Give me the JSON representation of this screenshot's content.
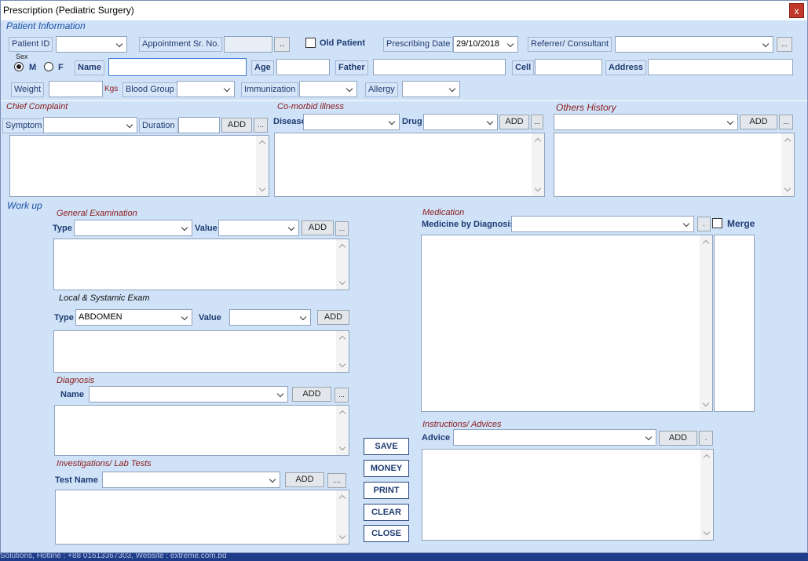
{
  "window": {
    "title": "Prescription (Pediatric Surgery)",
    "close_glyph": "x"
  },
  "patient_info": {
    "heading": "Patient Information",
    "patient_id_label": "Patient ID",
    "appointment_label": "Appointment Sr. No.",
    "appointment_browse": "..",
    "old_patient_label": "Old Patient",
    "prescribing_date_label": "Prescribing Date",
    "prescribing_date_value": "29/10/2018",
    "referrer_label": "Referrer/ Consultant",
    "referrer_more": "...",
    "sex_label": "Sex",
    "sex_m": "M",
    "sex_f": "F",
    "name_label": "Name",
    "age_label": "Age",
    "father_label": "Father",
    "cell_label": "Cell",
    "address_label": "Address",
    "weight_label": "Weight",
    "weight_unit": "Kgs",
    "blood_group_label": "Blood Group",
    "immunization_label": "Immunization",
    "allergy_label": "Allergy"
  },
  "chief_complaint": {
    "heading": "Chief Complaint",
    "symptom_label": "Symptom",
    "duration_label": "Duration",
    "add": "ADD",
    "more": "..."
  },
  "comorbid": {
    "heading": "Co-morbid illness",
    "disease_label": "Disease",
    "drug_label": "Drug",
    "add": "ADD",
    "more": "..."
  },
  "others_history": {
    "heading": "Others History",
    "add": "ADD",
    "more": "..."
  },
  "workup": {
    "heading": "Work up"
  },
  "general_exam": {
    "heading": "General Examination",
    "type_label": "Type",
    "value_label": "Value",
    "add": "ADD",
    "more": "..."
  },
  "local_exam": {
    "heading": "Local & Systamic Exam",
    "type_label": "Type",
    "type_value": "ABDOMEN",
    "value_label": "Value",
    "add": "ADD"
  },
  "diagnosis": {
    "heading": "Diagnosis",
    "name_label": "Name",
    "add": "ADD",
    "more": "..."
  },
  "investigations": {
    "heading": "Investigations/ Lab Tests",
    "test_label": "Test Name",
    "add": "ADD",
    "more": "...."
  },
  "medication": {
    "heading": "Medication",
    "medicine_label": "Medicine by Diagnosis",
    "more": ".",
    "merge_label": "Merge"
  },
  "instructions": {
    "heading": "Instructions/ Advices",
    "advice_label": "Advice",
    "add": "ADD",
    "more": "."
  },
  "actions": {
    "save": "SAVE",
    "money": "MONEY",
    "print": "PRINT",
    "clear": "CLEAR",
    "close": "CLOSE"
  },
  "statusbar": {
    "text": "Solutions, Hotline : +88 01613367303, Website : extreme.com.bd"
  }
}
